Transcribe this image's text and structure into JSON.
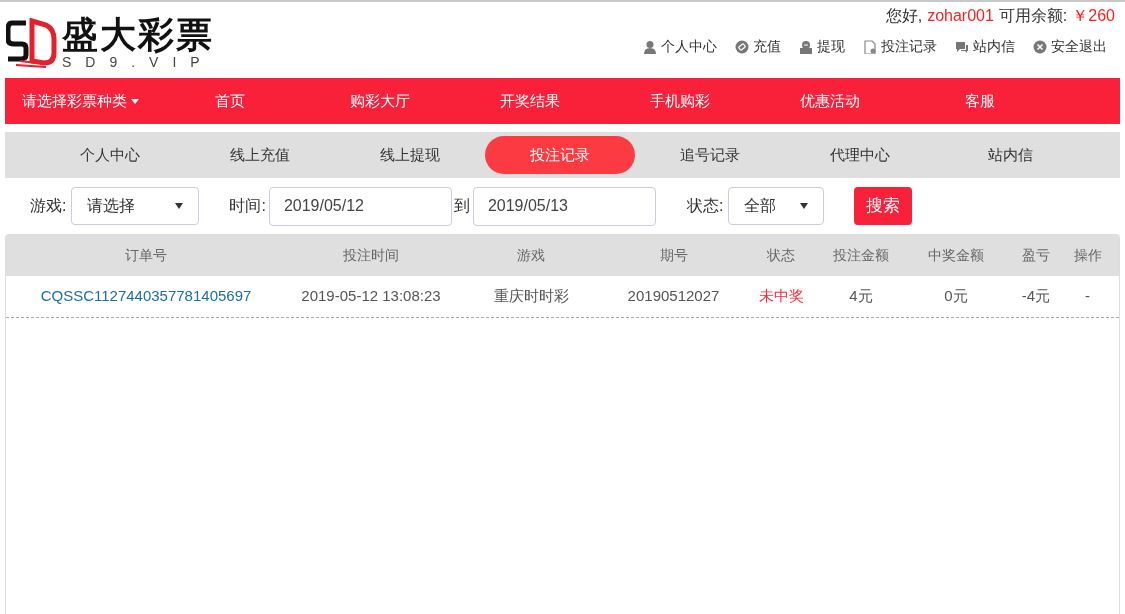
{
  "logo": {
    "name": "盛大彩票",
    "domain": "SD9.VIP"
  },
  "account": {
    "greeting": "您好,",
    "username": "zohar001",
    "balance_label": "可用余额:",
    "balance": "￥260"
  },
  "user_links": [
    {
      "kind": "person",
      "label": "个人中心"
    },
    {
      "kind": "recharge",
      "label": "充值"
    },
    {
      "kind": "withdraw",
      "label": "提现"
    },
    {
      "kind": "record",
      "label": "投注记录"
    },
    {
      "kind": "message",
      "label": "站内信"
    },
    {
      "kind": "logout",
      "label": "安全退出"
    }
  ],
  "main_nav": [
    {
      "kind": "dropdown",
      "label": "请选择彩票种类"
    },
    {
      "kind": "link",
      "label": "首页"
    },
    {
      "kind": "link",
      "label": "购彩大厅"
    },
    {
      "kind": "link",
      "label": "开奖结果"
    },
    {
      "kind": "link",
      "label": "手机购彩"
    },
    {
      "kind": "link",
      "label": "优惠活动"
    },
    {
      "kind": "link",
      "label": "客服"
    }
  ],
  "tabs": [
    {
      "label": "个人中心",
      "selected": false
    },
    {
      "label": "线上充值",
      "selected": false
    },
    {
      "label": "线上提现",
      "selected": false
    },
    {
      "label": "投注记录",
      "selected": true
    },
    {
      "label": "追号记录",
      "selected": false
    },
    {
      "label": "代理中心",
      "selected": false
    },
    {
      "label": "站内信",
      "selected": false
    }
  ],
  "filters": {
    "game_label": "游戏:",
    "game_value": "请选择",
    "time_label": "时间:",
    "date_from": "2019/05/12",
    "to_label": "到",
    "date_to": "2019/05/13",
    "status_label": "状态:",
    "status_value": "全部",
    "search_button": "搜索"
  },
  "table": {
    "columns": [
      "订单号",
      "投注时间",
      "游戏",
      "期号",
      "状态",
      "投注金额",
      "中奖金额",
      "盈亏",
      "操作"
    ],
    "rows": [
      [
        {
          "kind": "link",
          "text": "CQSSC1127440357781405697"
        },
        {
          "kind": "text",
          "text": "2019-05-12 13:08:23"
        },
        {
          "kind": "text",
          "text": "重庆时时彩"
        },
        {
          "kind": "text",
          "text": "20190512027"
        },
        {
          "kind": "alert",
          "text": "未中奖"
        },
        {
          "kind": "text",
          "text": "4元"
        },
        {
          "kind": "text",
          "text": "0元"
        },
        {
          "kind": "text",
          "text": "-4元"
        },
        {
          "kind": "text",
          "text": "-"
        }
      ]
    ]
  }
}
